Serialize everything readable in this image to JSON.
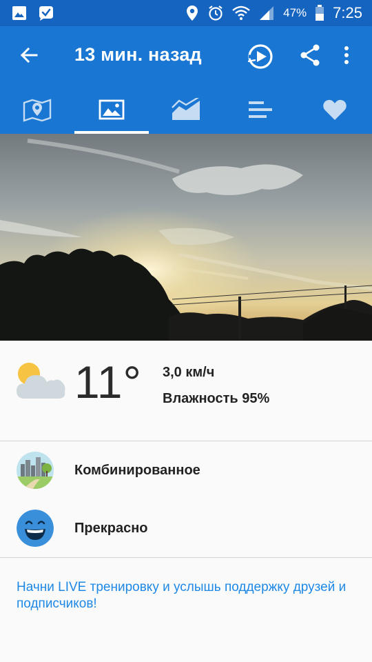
{
  "status_bar": {
    "battery": "47%",
    "time": "7:25"
  },
  "toolbar": {
    "title": "13 мин. назад"
  },
  "tabs": [
    {
      "icon": "map-icon"
    },
    {
      "icon": "image-icon",
      "selected": true
    },
    {
      "icon": "chart-icon"
    },
    {
      "icon": "bars-icon"
    },
    {
      "icon": "heart-icon"
    }
  ],
  "weather": {
    "icon": "partly-cloudy-icon",
    "temperature": "11°",
    "wind": "3,0 км/ч",
    "humidity": "Влажность 95%"
  },
  "surface": {
    "label": "Комбинированное"
  },
  "mood": {
    "label": "Прекрасно"
  },
  "live_link": "Начни LIVE тренировку и услышь поддержку друзей и подписчиков!",
  "colors": {
    "status_bar": "#1565c0",
    "app_bar": "#1976d2",
    "link": "#1e88e5"
  }
}
